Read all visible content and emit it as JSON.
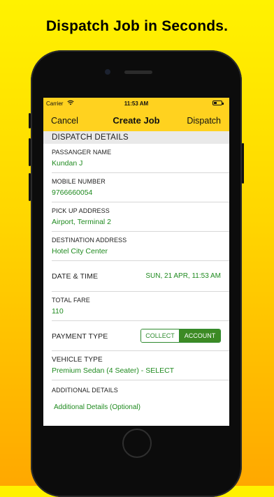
{
  "headline": "Dispatch Job in Seconds.",
  "status_bar": {
    "carrier": "Carrier",
    "time": "11:53 AM"
  },
  "nav": {
    "cancel": "Cancel",
    "title": "Create Job",
    "dispatch": "Dispatch"
  },
  "section_title": "DISPATCH DETAILS",
  "fields": {
    "passenger_name": {
      "label": "PASSANGER NAME",
      "value": "Kundan J"
    },
    "mobile_number": {
      "label": "MOBILE NUMBER",
      "value": "9766660054"
    },
    "pickup_address": {
      "label": "PICK UP ADDRESS",
      "value": "Airport, Terminal 2"
    },
    "destination_address": {
      "label": "DESTINATION ADDRESS",
      "value": "Hotel City Center"
    },
    "date_time": {
      "label": "DATE & TIME",
      "value": "SUN, 21 APR, 11:53 AM"
    },
    "total_fare": {
      "label": "TOTAL FARE",
      "value": "110"
    },
    "payment_type": {
      "label": "PAYMENT TYPE",
      "options": [
        "COLLECT",
        "ACCOUNT"
      ],
      "selected": "ACCOUNT"
    },
    "vehicle_type": {
      "label": "VEHICLE TYPE",
      "value": "Premium Sedan (4 Seater) - SELECT"
    },
    "additional_details": {
      "label": "ADDITIONAL DETAILS",
      "value": "Additional Details (Optional)"
    }
  },
  "colors": {
    "accent_yellow": "#ffd21f",
    "value_green": "#1f8a1f",
    "segment_green": "#3c8a24"
  }
}
